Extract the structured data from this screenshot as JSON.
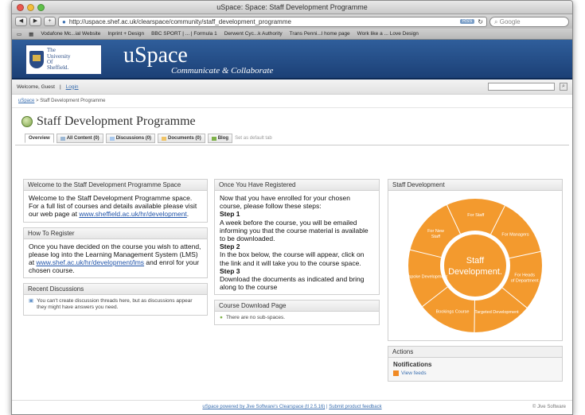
{
  "browser": {
    "window_title": "uSpace: Space: Staff Development Programme",
    "url": "http://uspace.shef.ac.uk/clearspace/community/staff_development_programme",
    "rss_label": "RSS",
    "search_placeholder": "Google",
    "bookmarks": [
      "Vodafone Mc...ial Website",
      "Inprint + Design",
      "BBC SPORT | ... | Formula 1",
      "Derwent Cyc...k Authority",
      "Trans Penni...l home page",
      "Work like a ... Love Design"
    ]
  },
  "header": {
    "logo_lines": [
      "The",
      "University",
      "Of",
      "Sheffield."
    ],
    "brand": "uSpace",
    "tagline": "Communicate & Collaborate"
  },
  "userbar": {
    "welcome": "Welcome, Guest",
    "login": "Login"
  },
  "breadcrumb": {
    "root": "uSpace",
    "separator": ">",
    "current": "Staff Development Programme"
  },
  "page": {
    "title": "Staff Development Programme"
  },
  "tabs": [
    {
      "label": "Overview"
    },
    {
      "label": "All Content (0)"
    },
    {
      "label": "Discussions (0)"
    },
    {
      "label": "Documents (0)"
    },
    {
      "label": "Blog"
    }
  ],
  "default_tab_text": "Set as default tab",
  "welcome": {
    "heading": "Welcome to the Staff Development Programme Space",
    "text": "Welcome to the Staff Development Programme space. For a full list of courses and details available please visit our web page at",
    "link": "www.sheffield.ac.uk/hr/development",
    "end": "."
  },
  "register": {
    "heading": "How To Register",
    "text": "Once you have decided on the course you wish to attend, please log into the Learning Management System (LMS) at",
    "link": "www.shef.ac.uk/hr/development/lms",
    "end": " and enrol for your chosen course."
  },
  "recent": {
    "heading": "Recent Discussions",
    "text": "You can't create discussion threads here, but as discussions appear they might have answers you need."
  },
  "registered": {
    "heading": "Once You Have Registered",
    "intro": "Now that you have enrolled for your chosen course, please follow these steps:",
    "step1": "Step 1",
    "step1_text": "A week before the course, you will be emailed informing you that the course material is available to be downloaded.",
    "step2": "Step 2",
    "step2_text": "In the box below, the course will appear, click on the link and it will take you to the course space.",
    "step3": "Step 3",
    "step3_text": "Download the documents as indicated and bring along to the course"
  },
  "download": {
    "heading": "Course Download Page",
    "text": "There are no sub-spaces."
  },
  "staffdev": {
    "heading": "Staff Development",
    "centre_line1": "Staff",
    "centre_line2": "Development.",
    "segments": [
      "For Staff",
      "For Managers",
      "For Heads of Department",
      "Targeted Development",
      "Bookings Course",
      "Bespoke Development",
      "For New Staff"
    ],
    "orange": "#f39a2e"
  },
  "actions": {
    "heading": "Actions",
    "notifications": "Notifications",
    "view_feeds": "View feeds"
  },
  "footer": {
    "text": "uSpace powered by Jive Software's Clearspace (tl 2.5.16)",
    "sep": "|",
    "feedback": "Submit product feedback",
    "right": "© Jive Software"
  }
}
